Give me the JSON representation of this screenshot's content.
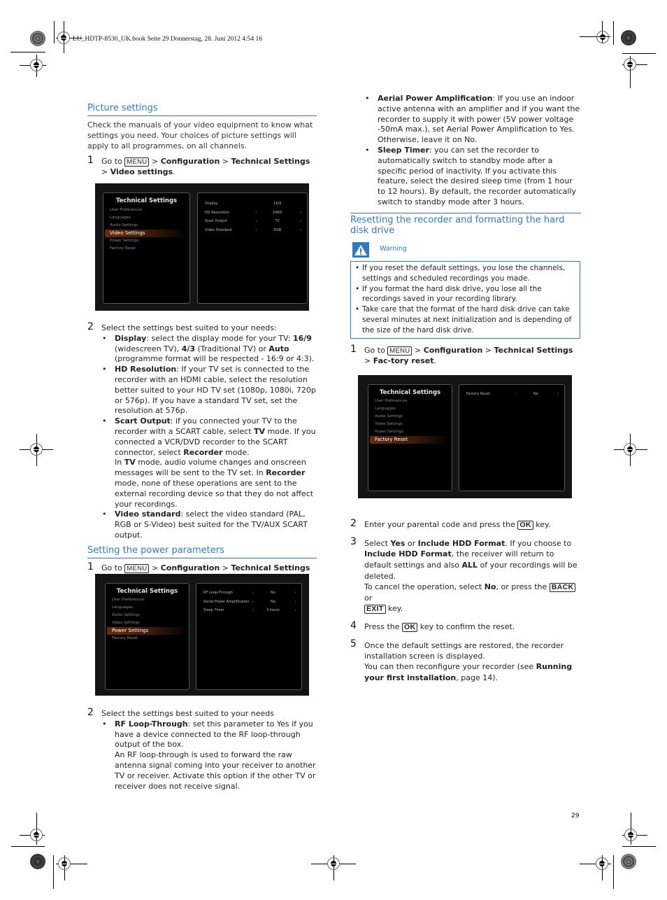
{
  "header": {
    "print_line": "LU_HDTP-8530_UK.book  Seite 29  Donnerstag, 28. Juni 2012  4:54 16"
  },
  "picture_settings": {
    "heading": "Picture settings",
    "intro": "Check the manuals of your video equipment to know what settings you need. Your choices of picture settings will apply to all programmes, on all channels.",
    "step1": {
      "num": "1",
      "pre": "Go to",
      "key": "MENU",
      "sep1": " > ",
      "b1": "Configuration",
      "sep2": " > ",
      "b2": "Technical Settings",
      "sep3": " > ",
      "b3": "Video settings",
      "end": "."
    },
    "screen": {
      "menu_title": "Technical Settings",
      "menu_items": [
        "User Preferences",
        "Languages",
        "Audio Settings",
        "Video Settings",
        "Power Settings",
        "Factory Reset"
      ],
      "selected_index": 3,
      "params": [
        {
          "label": "Display",
          "value": "16/9",
          "arrows": false
        },
        {
          "label": "HD Resolution",
          "value": "1080i",
          "arrows": true
        },
        {
          "label": "Scart Output",
          "value": "TV",
          "arrows": true
        },
        {
          "label": "Video Standard",
          "value": "RGB",
          "arrows": true
        }
      ]
    },
    "step2": {
      "num": "2",
      "text": "Select the settings best suited to your needs:",
      "bullets": [
        {
          "b": "Display",
          "t1": ": select the display mode for your TV: ",
          "b2": "16/9",
          "t2": " (widescreen TV), ",
          "b3": "4/3",
          "t3": " (Traditional TV) or ",
          "b4": "Auto",
          "t4": " (programme format will be respected - 16:9 or 4:3)."
        },
        {
          "b": "HD Resolution",
          "t1": ": If your TV set is connected to the recorder with an HDMI cable, select the resolution better suited to your HD TV set (1080p, 1080i, 720p or 576p). If you have a standard TV set, set the resolution at 576p."
        },
        {
          "b": "Scart Output",
          "t1": ": if you connected your TV to the recorder with a SCART cable, select ",
          "b2": "TV",
          "t2": " mode. If you connected a VCR/DVD recorder to the SCART connector, select ",
          "b3": "Recorder",
          "t3": " mode.",
          "p2a": "In ",
          "p2b": "TV",
          "p2c": " mode, audio volume changes and onscreen messages will be sent to the TV set. In ",
          "p2d": "Recorder",
          "p2e": " mode, none of these operations are sent to the external recording device so that they do not affect your recordings."
        },
        {
          "b": "Video standard",
          "t1": ": select the video standard (PAL, RGB or S-Video) best suited for the TV/AUX SCART output."
        }
      ]
    }
  },
  "power_parameters": {
    "heading": "Setting the power parameters",
    "step1": {
      "num": "1",
      "pre": "Go to",
      "key": "MENU",
      "sep1": " > ",
      "b1": "Configuration",
      "sep2": " > ",
      "b2": "Technical Settings",
      "sep3": " > ",
      "b3": "Power Settings",
      "end": "."
    },
    "screen": {
      "menu_title": "Technical Settings",
      "menu_items": [
        "User Preferences",
        "Languages",
        "Audio Settings",
        "Video Settings",
        "Power Settings",
        "Factory Reset"
      ],
      "selected_index": 4,
      "params": [
        {
          "label": "RF Loop-Through",
          "value": "No",
          "arrows": true
        },
        {
          "label": "Aerial Power Amplification",
          "value": "No",
          "arrows": true
        },
        {
          "label": "Sleep Timer",
          "value": "3 hours",
          "arrows": true
        }
      ]
    },
    "step2": {
      "num": "2",
      "text": "Select the settings best suited to your needs",
      "bullets": [
        {
          "b": "RF Loop-Through",
          "t1": ": set this parameter to Yes if you have a device connected to the RF loop-through output of the box.",
          "p2": "An RF loop-through is used to forward the raw antenna signal coming into your receiver to another TV or receiver. Activate this option if the other TV or receiver does not receive signal."
        },
        {
          "b": "Aerial Power Amplification",
          "t1": ": If you use an indoor active antenna with an amplifier and if you want the recorder to supply it with power (5V power voltage -50mA max.), set Aerial Power Amplification to Yes. Otherwise, leave it on No."
        },
        {
          "b": "Sleep Timer",
          "t1": ": you can set the recorder to automatically switch to standby mode after a specific period of inactivity. If you activate this feature, select the desired sleep time (from 1 hour to 12 hours). By default, the recorder automatically switch to standby mode after 3 hours."
        }
      ]
    }
  },
  "reset_section": {
    "heading": "Resetting the recorder and formatting the hard disk drive",
    "warning": {
      "icon": "warning-triangle-icon",
      "title": "Warning",
      "items": [
        "If you reset the default settings, you lose the channels, settings and scheduled recordings you made.",
        "If you format the hard disk drive, you lose all the recordings saved in your recording library.",
        "Take care that the format of the hard disk drive can take several minutes at next initialization and is depending of the size of the hard disk drive."
      ]
    },
    "step1": {
      "num": "1",
      "pre": "Go to",
      "key": "MENU",
      "sep1": " > ",
      "b1": "Configuration",
      "sep2": " > ",
      "b2": "Technical Settings",
      "sep3": " > ",
      "b3": "Fac-tory reset",
      "end": "."
    },
    "screen": {
      "menu_title": "Technical Settings",
      "menu_items": [
        "User Preferences",
        "Languages",
        "Audio Settings",
        "Video Settings",
        "Power Settings",
        "Factory Reset"
      ],
      "selected_index": 5,
      "params": [
        {
          "label": "Factory Reset",
          "value": "No",
          "arrows": true
        }
      ]
    },
    "step2": {
      "num": "2",
      "t1": "Enter your parental code and press the",
      "key": "OK",
      "t2": "key."
    },
    "step3": {
      "num": "3",
      "t1": "Select ",
      "b1": "Yes",
      "t2": " or ",
      "b2": "Include HDD Format",
      "t3": ". If you choose to ",
      "b3": "Include HDD Format",
      "t4": ", the receiver will return to default settings and also ",
      "b4": "ALL",
      "t5": " of your recordings will be deleted.",
      "p2a": "To cancel the operation, select ",
      "p2b": "No",
      "p2c": ", or press the",
      "key1": "BACK",
      "p2d": "or",
      "key2": "EXIT",
      "p2e": "key."
    },
    "step4": {
      "num": "4",
      "t1": "Press the",
      "key": "OK",
      "t2": "key to confirm the reset."
    },
    "step5": {
      "num": "5",
      "t1": "Once the default settings are restored, the recorder installation screen is displayed.",
      "p2a": "You can then reconfigure your recorder (see ",
      "p2b": "Running your first installation",
      "p2c": ", page 14)."
    }
  },
  "footer": {
    "page_number": "29"
  }
}
